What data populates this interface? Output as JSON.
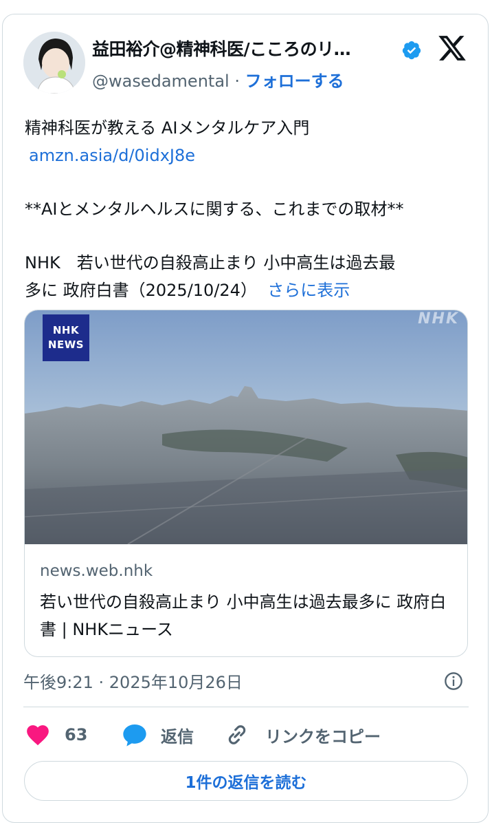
{
  "author": {
    "name": "益田裕介@精神科医/こころのリ…",
    "handle": "@wasedamental",
    "separator": " · ",
    "follow_label": "フォローする"
  },
  "tweet": {
    "line1": "精神科医が教える AIメンタルケア入門",
    "link": "amzn.asia/d/0idxJ8e",
    "line2": "**AIとメンタルヘルスに関する、これまでの取材**",
    "line3": "NHK　若い世代の自殺高止まり 小中高生は過去最",
    "line4": "多に 政府白書（2025/10/24）",
    "show_more": "さらに表示"
  },
  "link_card": {
    "badge_line1": "NHK",
    "badge_line2": "NEWS",
    "watermark": "NHK",
    "domain": "news.web.nhk",
    "title": "若い世代の自殺高止まり 小中高生は過去最多に 政府白書 | NHKニュース"
  },
  "timestamp": "午後9:21 · 2025年10月26日",
  "actions": {
    "likes": "63",
    "reply_label": "返信",
    "copy_label": "リンクをコピー"
  },
  "read_replies_label": "1件の返信を読む",
  "colors": {
    "accent": "#1d6fd8",
    "heart": "#f91880",
    "verified": "#1d9bf0",
    "border": "#cfd9de",
    "muted": "#536471"
  },
  "icons": [
    "verified-badge-icon",
    "x-logo-icon",
    "info-icon",
    "heart-icon",
    "reply-bubble-icon",
    "link-icon"
  ]
}
